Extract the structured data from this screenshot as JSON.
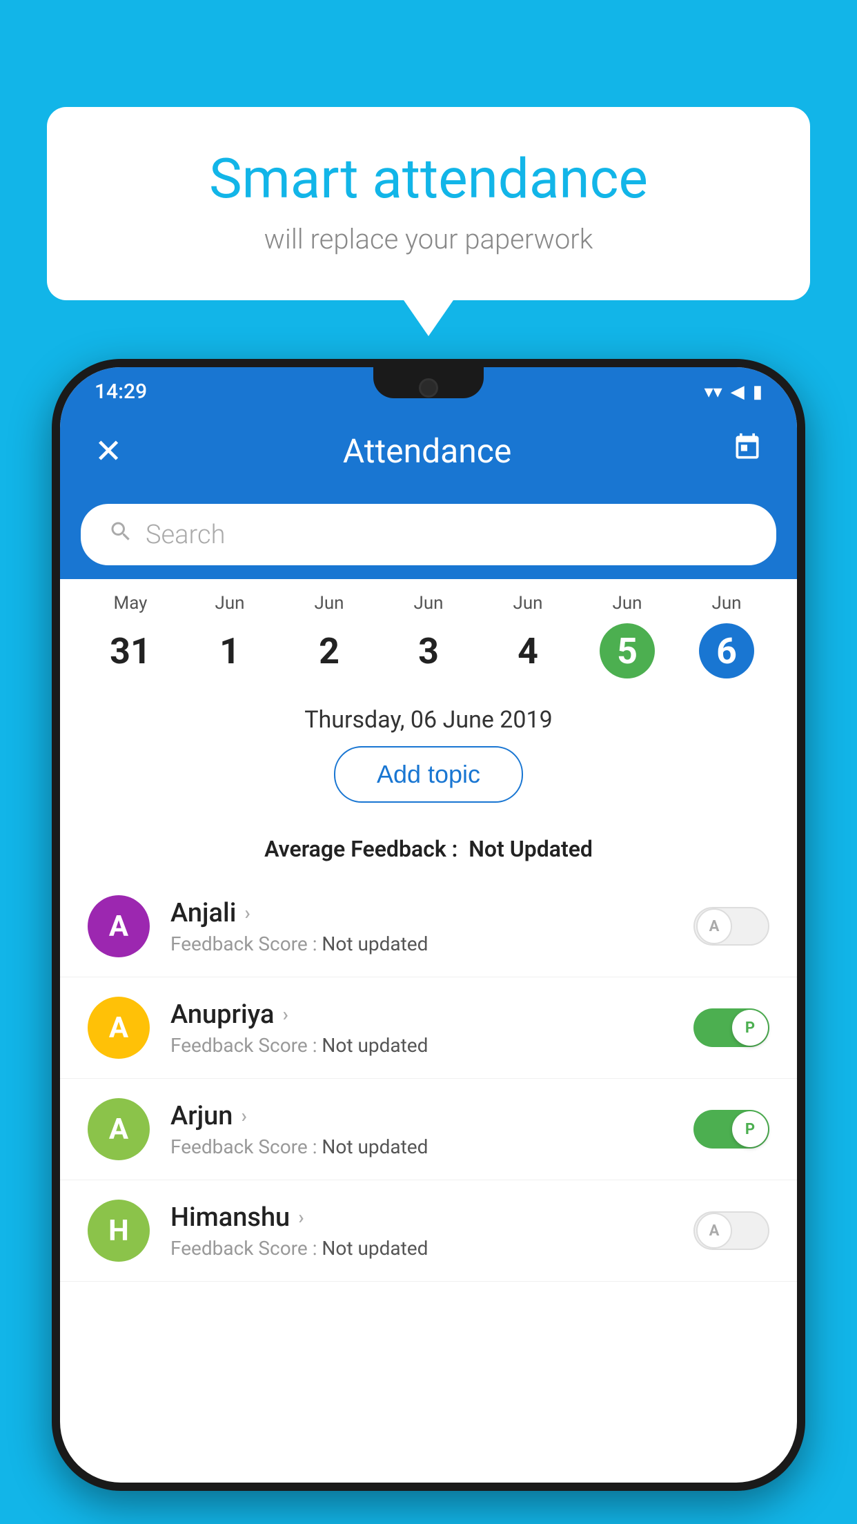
{
  "background": {
    "color": "#12B5E8"
  },
  "speech_bubble": {
    "title": "Smart attendance",
    "subtitle": "will replace your paperwork"
  },
  "phone": {
    "status_bar": {
      "time": "14:29",
      "wifi": "▾",
      "signal": "▲",
      "battery": "▮"
    },
    "header": {
      "close_label": "✕",
      "title": "Attendance",
      "calendar_icon": "📅"
    },
    "search": {
      "placeholder": "Search"
    },
    "calendar": {
      "days": [
        {
          "month": "May",
          "number": "31",
          "state": "normal"
        },
        {
          "month": "Jun",
          "number": "1",
          "state": "normal"
        },
        {
          "month": "Jun",
          "number": "2",
          "state": "normal"
        },
        {
          "month": "Jun",
          "number": "3",
          "state": "normal"
        },
        {
          "month": "Jun",
          "number": "4",
          "state": "normal"
        },
        {
          "month": "Jun",
          "number": "5",
          "state": "today"
        },
        {
          "month": "Jun",
          "number": "6",
          "state": "selected"
        }
      ]
    },
    "selected_date": "Thursday, 06 June 2019",
    "add_topic_label": "Add topic",
    "avg_feedback_label": "Average Feedback :",
    "avg_feedback_value": "Not Updated",
    "students": [
      {
        "name": "Anjali",
        "avatar_letter": "A",
        "avatar_color": "#9C27B0",
        "feedback_label": "Feedback Score :",
        "feedback_value": "Not updated",
        "toggle_state": "off",
        "toggle_letter": "A"
      },
      {
        "name": "Anupriya",
        "avatar_letter": "A",
        "avatar_color": "#FFC107",
        "feedback_label": "Feedback Score :",
        "feedback_value": "Not updated",
        "toggle_state": "on",
        "toggle_letter": "P"
      },
      {
        "name": "Arjun",
        "avatar_letter": "A",
        "avatar_color": "#8BC34A",
        "feedback_label": "Feedback Score :",
        "feedback_value": "Not updated",
        "toggle_state": "on",
        "toggle_letter": "P"
      },
      {
        "name": "Himanshu",
        "avatar_letter": "H",
        "avatar_color": "#8BC34A",
        "feedback_label": "Feedback Score :",
        "feedback_value": "Not updated",
        "toggle_state": "off",
        "toggle_letter": "A"
      }
    ]
  }
}
